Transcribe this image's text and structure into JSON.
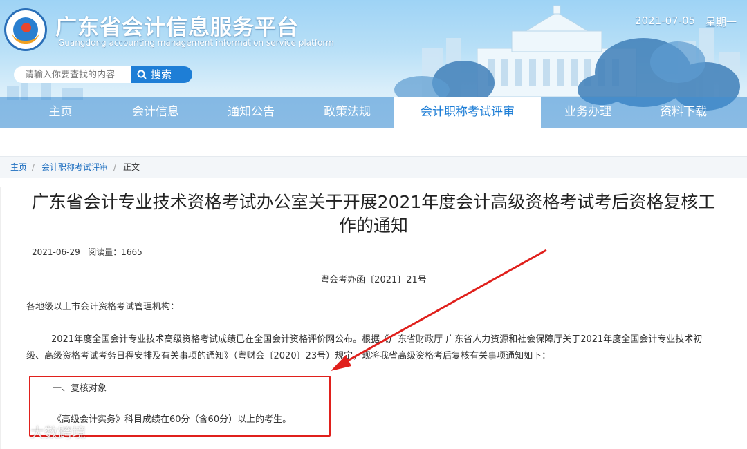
{
  "header": {
    "site_title": "广东省会计信息服务平台",
    "site_subtitle": "Guangdong accounting management information service platform",
    "date": "2021-07-05",
    "weekday": "星期一"
  },
  "search": {
    "placeholder": "请输入你要查找的内容",
    "button_label": "搜索"
  },
  "nav": {
    "items": [
      {
        "label": "主页"
      },
      {
        "label": "会计信息"
      },
      {
        "label": "通知公告"
      },
      {
        "label": "政策法规"
      },
      {
        "label": "会计职称考试评审",
        "active": true
      },
      {
        "label": "业务办理"
      },
      {
        "label": "资料下载"
      }
    ]
  },
  "breadcrumb": {
    "home": "主页",
    "sep": "/",
    "section": "会计职称考试评审",
    "current": "正文"
  },
  "article": {
    "title": "广东省会计专业技术资格考试办公室关于开展2021年度会计高级资格考试考后资格复核工作的通知",
    "date": "2021-06-29",
    "views_label": "阅读量：",
    "views": "1665",
    "doc_number": "粤会考办函〔2021〕21号",
    "salutation": "各地级以上市会计资格考试管理机构：",
    "para1": "2021年度全国会计专业技术高级资格考试成绩已在全国会计资格评价网公布。根据《广东省财政厅 广东省人力资源和社会保障厅关于2021年度全国会计专业技术初级、高级资格考试考务日程安排及有关事项的通知》（粤财会〔2020〕23号）规定，现将我省高级资格考后复核有关事项通知如下：",
    "section1_title": "一、复核对象",
    "section1_body": "《高级会计实务》科目成绩在60分（含60分）以上的考生。"
  },
  "watermark": {
    "text": "大数跨境"
  },
  "colors": {
    "accent": "#1e7ed6",
    "highlight": "#e0201c"
  }
}
